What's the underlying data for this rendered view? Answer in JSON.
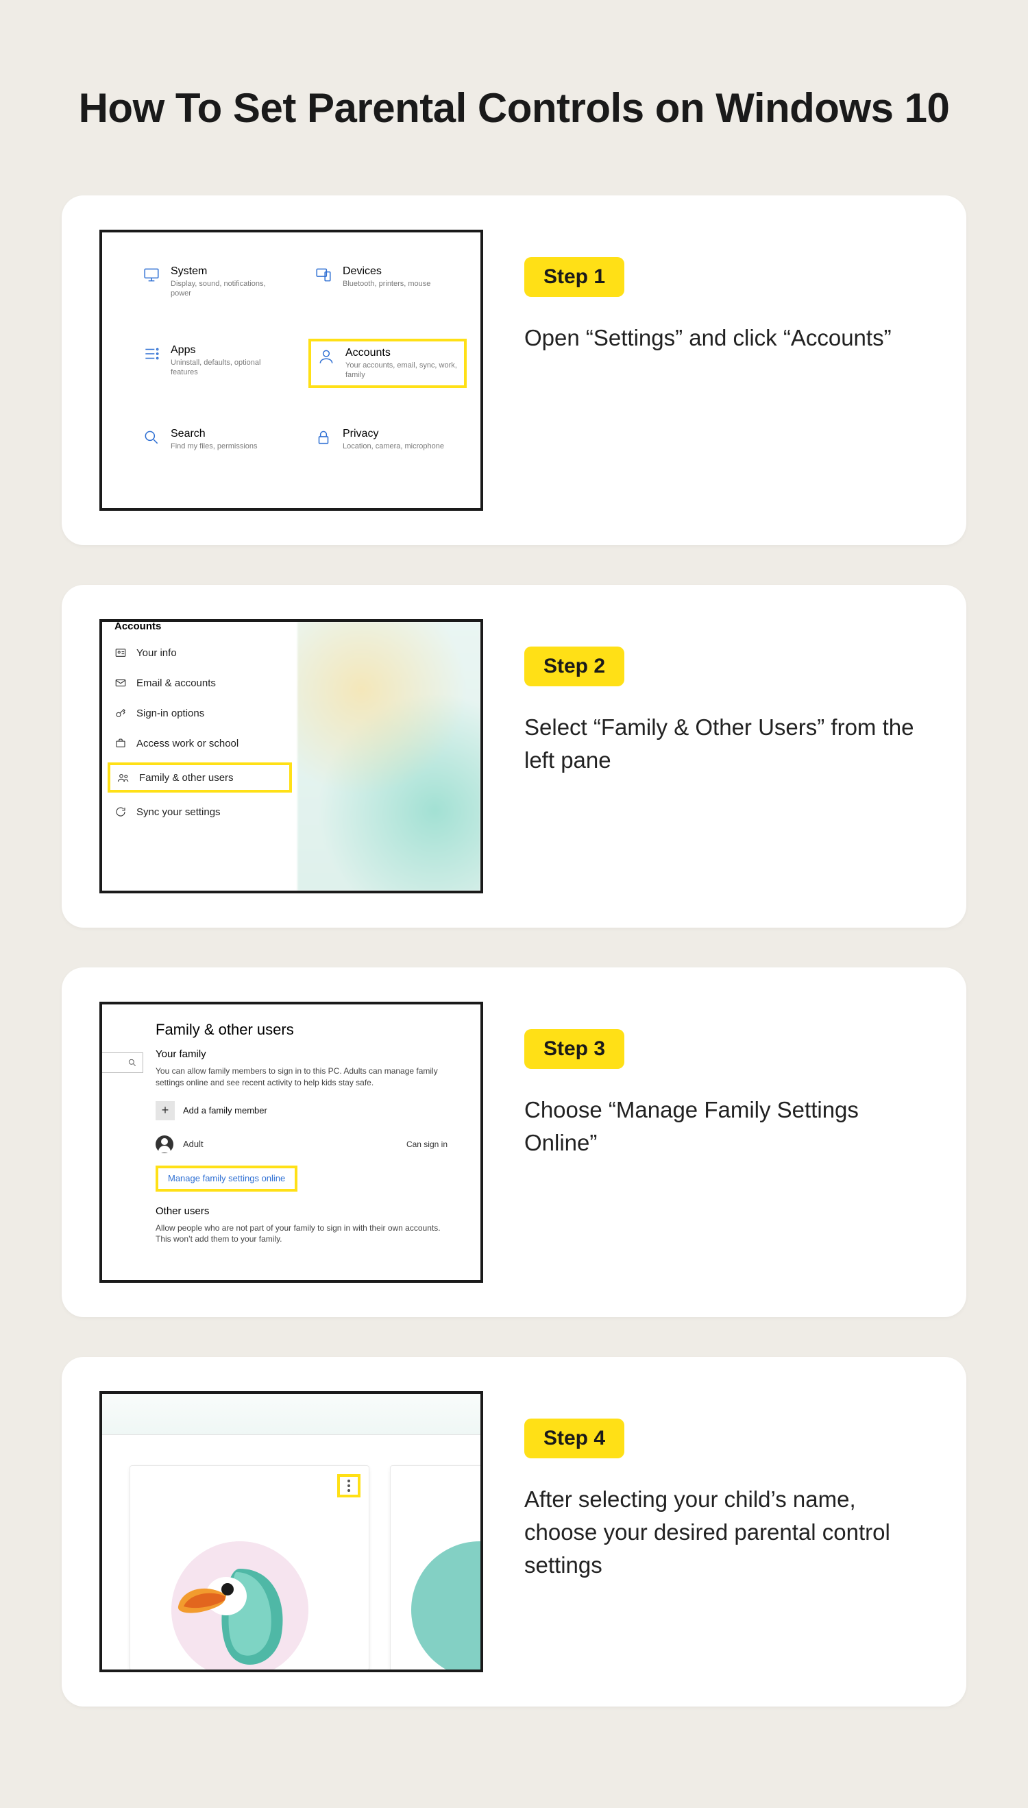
{
  "title": "How To Set Parental Controls on Windows 10",
  "steps": [
    {
      "badge": "Step 1",
      "desc": "Open “Settings” and click “Accounts”"
    },
    {
      "badge": "Step 2",
      "desc": "Select “Family & Other Users” from the left pane"
    },
    {
      "badge": "Step 3",
      "desc": "Choose “Manage Family Settings Online”"
    },
    {
      "badge": "Step 4",
      "desc": "After selecting your child’s name, choose your desired parental control settings"
    }
  ],
  "step1": {
    "items": [
      {
        "title": "System",
        "sub": "Display, sound, notifications, power"
      },
      {
        "title": "Devices",
        "sub": "Bluetooth, printers, mouse"
      },
      {
        "title": "Apps",
        "sub": "Uninstall, defaults, optional features"
      },
      {
        "title": "Accounts",
        "sub": "Your accounts, email, sync, work, family"
      },
      {
        "title": "Search",
        "sub": "Find my files, permissions"
      },
      {
        "title": "Privacy",
        "sub": "Location, camera, microphone"
      }
    ]
  },
  "step2": {
    "header": "Accounts",
    "items": [
      "Your info",
      "Email & accounts",
      "Sign-in options",
      "Access work or school",
      "Family & other users",
      "Sync your settings"
    ]
  },
  "step3": {
    "h1": "Family & other users",
    "h2a": "Your family",
    "p1": "You can allow family members to sign in to this PC. Adults can manage family settings online and see recent activity to help kids stay safe.",
    "add": "Add a family member",
    "adult": "Adult",
    "signin": "Can sign in",
    "link": "Manage family settings online",
    "h2b": "Other users",
    "p2": "Allow people who are not part of your family to sign in with their own accounts. This won’t add them to your family."
  }
}
